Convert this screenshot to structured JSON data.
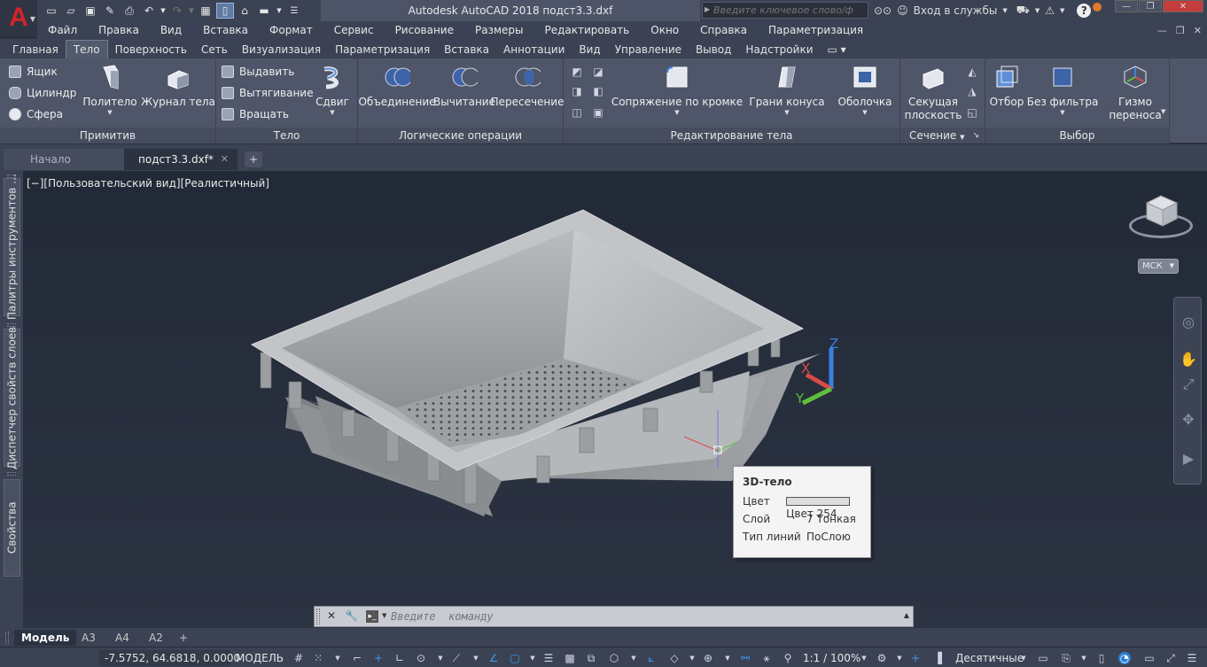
{
  "window": {
    "title": "Autodesk AutoCAD 2018    подст3.3.dxf",
    "search_placeholder": "Введите ключевое слово/фразу",
    "signin": "Вход в службы"
  },
  "menu": [
    "Файл",
    "Правка",
    "Вид",
    "Вставка",
    "Формат",
    "Сервис",
    "Рисование",
    "Размеры",
    "Редактировать",
    "Окно",
    "Справка",
    "Параметризация"
  ],
  "ribbon_tabs": [
    "Главная",
    "Тело",
    "Поверхность",
    "Сеть",
    "Визуализация",
    "Параметризация",
    "Вставка",
    "Аннотации",
    "Вид",
    "Управление",
    "Вывод",
    "Надстройки"
  ],
  "active_ribbon_tab": "Тело",
  "ribbon": {
    "primitive": {
      "title": "Примитив",
      "box": "Ящик",
      "cylinder": "Цилиндр",
      "sphere": "Сфера",
      "polysolid": "Политело",
      "history": "Журнал тела"
    },
    "solid": {
      "title": "Тело",
      "extrude": "Выдавить",
      "loft": "Вытягивание",
      "revolve": "Вращать",
      "sweep": "Сдвиг"
    },
    "boolean": {
      "title": "Логические операции",
      "union": "Объединение",
      "subtract": "Вычитание",
      "intersect": "Пересечение"
    },
    "edit": {
      "title": "Редактирование тела",
      "fillet": "Сопряжение по кромке",
      "taper": "Грани конуса",
      "shell": "Оболочка"
    },
    "section": {
      "title": "Сечение",
      "plane_1": "Секущая",
      "plane_2": "плоскость"
    },
    "select": {
      "title": "Выбор",
      "cull": "Отбор",
      "nofilter": "Без фильтра",
      "gizmo_1": "Гизмо",
      "gizmo_2": "переноса"
    }
  },
  "doc_tabs": [
    {
      "label": "Начало"
    },
    {
      "label": "подст3.3.dxf*"
    }
  ],
  "palettes": {
    "tools": "Палитры инструментов ...",
    "layers": "Диспетчер свойств слоев",
    "props": "Свойства"
  },
  "viewport": {
    "label": "[−][Пользовательский вид][Реалистичный]",
    "ucs": "МСК",
    "axes": {
      "x": "X",
      "y": "Y",
      "z": "Z"
    }
  },
  "tooltip": {
    "title": "3D-тело",
    "rows": [
      {
        "k": "Цвет",
        "v": "Цвет 254"
      },
      {
        "k": "Слой",
        "v": "7 Тонкая"
      },
      {
        "k": "Тип линий",
        "v": "ПоСлою"
      }
    ]
  },
  "command": {
    "placeholder": "Введите  команду"
  },
  "layout_tabs": [
    "Модель",
    "A3",
    "A4",
    "A2"
  ],
  "status": {
    "coords": "-7.5752, 64.6818, 0.0000",
    "space": "МОДЕЛЬ",
    "scale": "1:1 / 100%",
    "units": "Десятичные"
  },
  "colors": {
    "accent": "#d3232a",
    "ribbon_bg": "#4f5669",
    "viewport_bg": "#252c3a",
    "axis_x": "#d94a4a",
    "axis_y": "#5fbf3a",
    "axis_z": "#3b7fe0"
  }
}
